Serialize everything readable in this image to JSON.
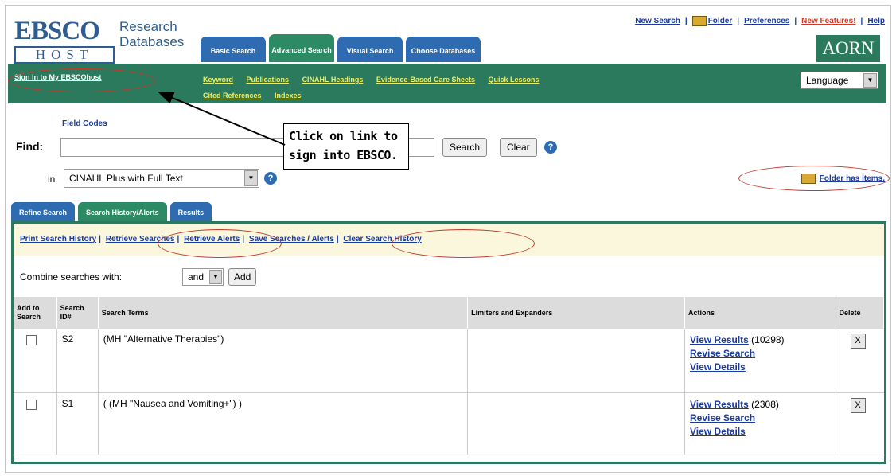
{
  "header": {
    "logo_top": "EBSCO",
    "logo_bottom": "HOST",
    "research_databases": "Research\nDatabases",
    "top_tabs": [
      {
        "label": "Basic Search",
        "active": false
      },
      {
        "label": "Advanced Search",
        "active": true
      },
      {
        "label": "Visual Search",
        "active": false
      },
      {
        "label": "Choose Databases",
        "active": false
      }
    ],
    "top_links": [
      "New Search",
      "Folder",
      "Preferences",
      "New Features!",
      "Help"
    ],
    "aorn": "AORN"
  },
  "navbar": {
    "signin": "Sign In to My EBSCOhost",
    "links": [
      "Keyword",
      "Publications",
      "CINAHL Headings",
      "Evidence-Based Care Sheets",
      "Quick Lessons",
      "Cited References",
      "Indexes"
    ],
    "language": "Language"
  },
  "search": {
    "field_codes": "Field Codes",
    "find_label": "Find:",
    "find_value": "",
    "search_button": "Search",
    "clear_button": "Clear",
    "in_label": "in",
    "database": "CINAHL Plus with Full Text",
    "folder_has_items": "Folder has items."
  },
  "callout": "Click on link to sign into EBSCO.",
  "lower_tabs": [
    {
      "label": "Refine Search",
      "active": false
    },
    {
      "label": "Search History/Alerts",
      "active": true
    },
    {
      "label": "Results",
      "active": false
    }
  ],
  "history": {
    "links": [
      "Print Search History",
      "Retrieve Searches",
      "Retrieve Alerts",
      "Save Searches / Alerts",
      "Clear Search History"
    ],
    "combine_label": "Combine searches with:",
    "combine_value": "and",
    "add_button": "Add",
    "columns": [
      "Add to Search",
      "Search ID#",
      "Search Terms",
      "Limiters and Expanders",
      "Actions",
      "Delete"
    ],
    "rows": [
      {
        "id": "S2",
        "terms": "(MH \"Alternative Therapies\")",
        "limiters": "",
        "view_results": "View Results",
        "count": "(10298)",
        "revise": "Revise Search",
        "details": "View Details"
      },
      {
        "id": "S1",
        "terms": "( (MH \"Nausea and Vomiting+\") )",
        "limiters": "",
        "view_results": "View Results",
        "count": "(2308)",
        "revise": "Revise Search",
        "details": "View Details"
      }
    ]
  },
  "colors": {
    "green": "#2c7a5e",
    "blue": "#2e6bb0",
    "annotation": "#c0392b"
  }
}
